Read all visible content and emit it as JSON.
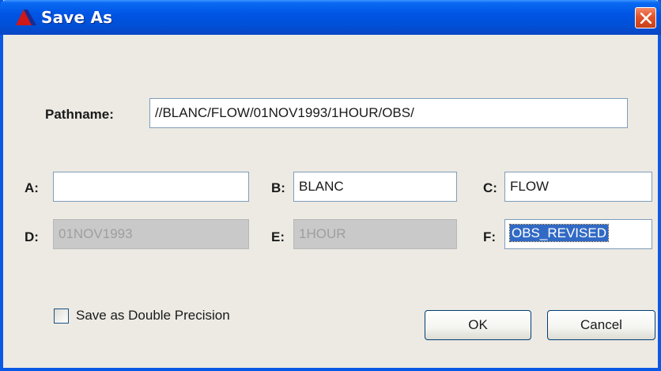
{
  "window": {
    "title": "Save As"
  },
  "form": {
    "pathname_label": "Pathname:",
    "pathname_value": "//BLANC/FLOW/01NOV1993/1HOUR/OBS/",
    "a_label": "A:",
    "a_value": "",
    "b_label": "B:",
    "b_value": "BLANC",
    "c_label": "C:",
    "c_value": "FLOW",
    "d_label": "D:",
    "d_value": "01NOV1993",
    "e_label": "E:",
    "e_value": "1HOUR",
    "f_label": "F:",
    "f_value": "OBS_REVISED"
  },
  "options": {
    "double_precision_label": "Save as Double Precision",
    "double_precision_checked": false
  },
  "buttons": {
    "ok": "OK",
    "cancel": "Cancel"
  },
  "colors": {
    "titlebar": "#0055e5",
    "close_button": "#e2532a",
    "dialog_background": "#eceae3",
    "selection": "#316ac5"
  },
  "icons": {
    "app": "triangle-logo-icon",
    "close": "close-icon"
  }
}
